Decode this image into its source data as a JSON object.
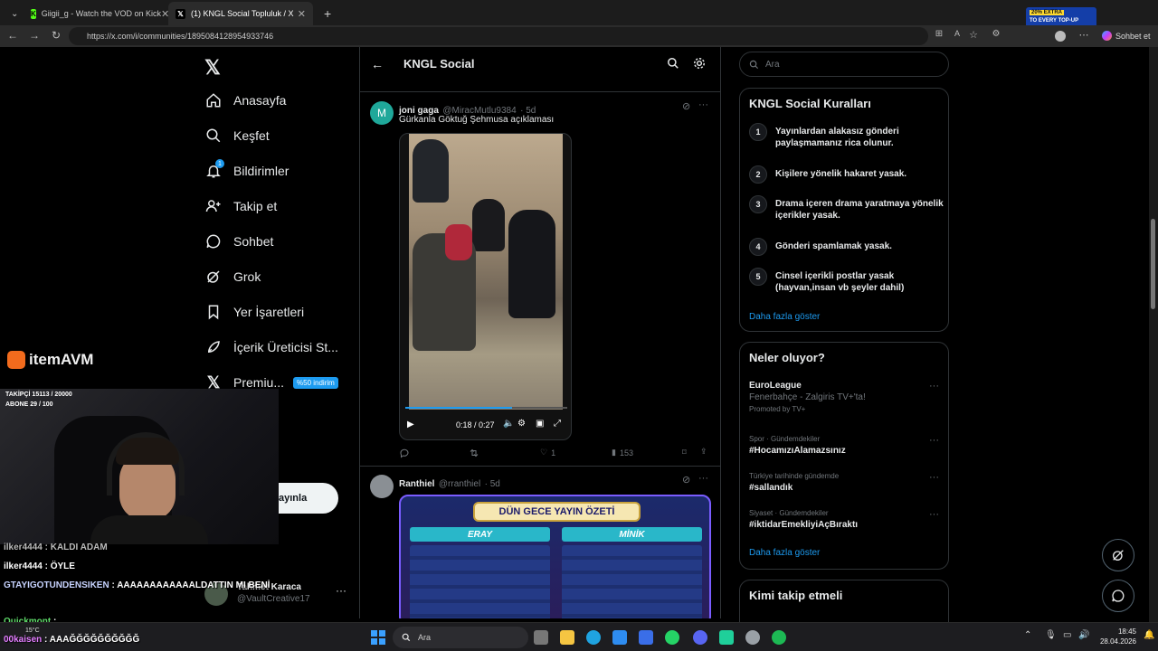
{
  "browser": {
    "tabs": [
      {
        "title": "Giigii_g - Watch the VOD on Kick"
      },
      {
        "title": "(1) KNGL Social Topluluk / X"
      }
    ],
    "url": "https://x.com/i/communities/1895084128954933746",
    "promo_line1": "20% EXTRA",
    "promo_line2": "TO EVERY TOP-UP",
    "chat_button": "Sohbet et"
  },
  "nav": {
    "items": [
      {
        "label": "Anasayfa",
        "icon": "home-icon"
      },
      {
        "label": "Keşfet",
        "icon": "search-icon"
      },
      {
        "label": "Bildirimler",
        "icon": "bell-icon"
      },
      {
        "label": "Takip et",
        "icon": "add-user-icon"
      },
      {
        "label": "Sohbet",
        "icon": "chat-icon"
      },
      {
        "label": "Grok",
        "icon": "grok-icon"
      },
      {
        "label": "Yer İşaretleri",
        "icon": "bookmark-icon"
      },
      {
        "label": "İçerik Üreticisi St...",
        "icon": "rocket-icon"
      },
      {
        "label": "Premiu...",
        "icon": "x-icon"
      }
    ],
    "premium_badge": "%50 indirim",
    "notification_count": "1",
    "more_partial": "zla",
    "post_button_partial": "ayınla",
    "account_name": "Tahmet Karaca",
    "account_handle": "@VaultCreative17"
  },
  "header": {
    "title": "KNGL Social"
  },
  "tweets": [
    {
      "avatar_letter": "M",
      "name": "joni gaga",
      "handle": "@MiracMutlu9384",
      "time": "· 5d",
      "text": "Gürkanla Göktuğ Şehmusa açıklaması",
      "video_time": "0:18 / 0:27",
      "replies": "",
      "retweets": "",
      "likes": "1",
      "views": "153"
    },
    {
      "name": "Ranthiel",
      "handle": "@rranthiel",
      "time": "· 5d",
      "image_title": "DÜN GECE YAYIN ÖZETİ",
      "image_left": "ERAY",
      "image_right": "MİNİK"
    }
  ],
  "right": {
    "search_placeholder": "Ara",
    "rules_title": "KNGL Social Kuralları",
    "rules": [
      {
        "n": "1",
        "text": "Yayınlardan alakasız gönderi paylaşmamanız rica olunur."
      },
      {
        "n": "2",
        "text": "Kişilere yönelik hakaret yasak."
      },
      {
        "n": "3",
        "text": "Drama içeren drama yaratmaya yönelik içerikler yasak."
      },
      {
        "n": "4",
        "text": "Gönderi spamlamak yasak."
      },
      {
        "n": "5",
        "text": "Cinsel içerikli postlar yasak (hayvan,insan vb şeyler dahil)"
      }
    ],
    "rules_more": "Daha fazla göster",
    "trends_title": "Neler oluyor?",
    "trends": [
      {
        "meta": "",
        "topic": "EuroLeague",
        "sub": "Fenerbahçe - Zalgiris TV+'ta!",
        "promo": "Promoted by TV+"
      },
      {
        "meta": "Spor · Gündemdekiler",
        "topic": "#HocamızıAlamazsınız"
      },
      {
        "meta": "Türkiye tarihinde gündemde",
        "topic": "#sallandık"
      },
      {
        "meta": "Siyaset · Gündemdekiler",
        "topic": "#iktidarEmekliyiAçBıraktı"
      }
    ],
    "trends_more": "Daha fazla göster",
    "follow_title": "Kimi takip etmeli"
  },
  "overlay": {
    "brand": "itemAVM",
    "followers": "TAKİPÇİ 15113 / 20000",
    "subs": "ABONE 29 / 100"
  },
  "chat": [
    {
      "user": "ilker4444",
      "msg": "KALDI ADAM"
    },
    {
      "user": "ilker4444",
      "msg": "ÖYLE"
    },
    {
      "user": "GTAYIGOTUNDENSIKEN",
      "msg": "AAAAAAAAAAAALDATTIN MI BENİ"
    },
    {
      "user": "Quickmont",
      "msg": ""
    },
    {
      "user": "00kaisen",
      "msg": "AAAĞĞĞĞĞĞĞĞĞĞ"
    }
  ],
  "taskbar": {
    "search": "Ara",
    "weather": "15°C",
    "time": "18:45",
    "date": "28.04.2026"
  }
}
